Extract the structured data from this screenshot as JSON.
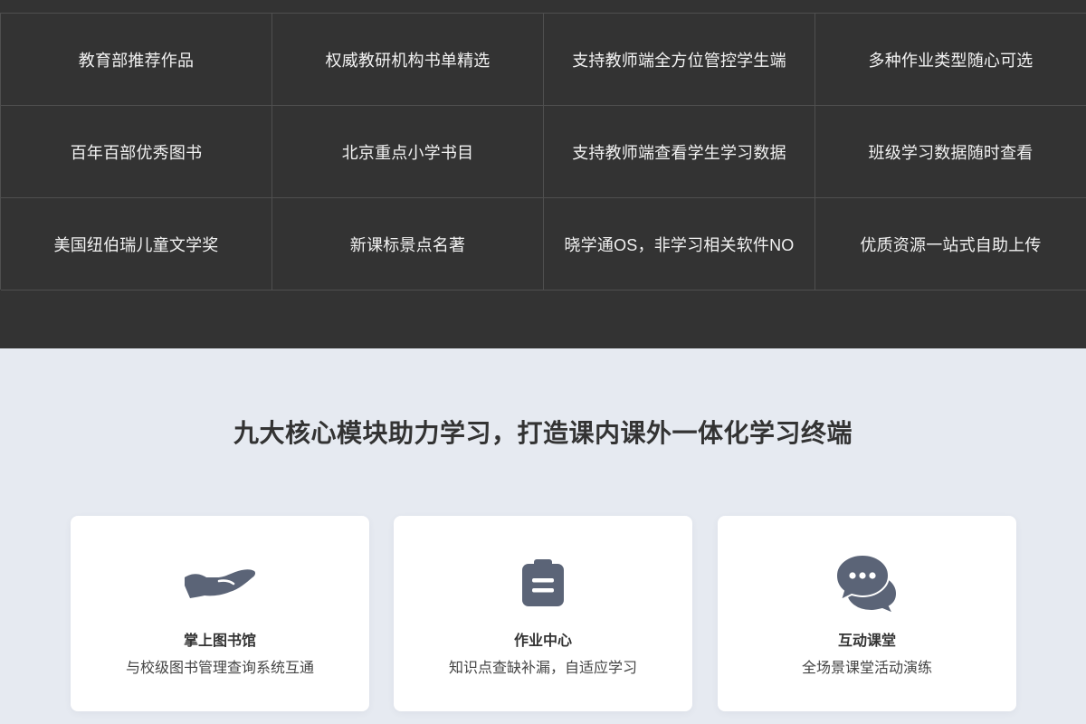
{
  "features": {
    "row1": [
      "教育部推荐作品",
      "权威教研机构书单精选",
      "支持教师端全方位管控学生端",
      "多种作业类型随心可选"
    ],
    "row2": [
      "百年百部优秀图书",
      "北京重点小学书目",
      "支持教师端查看学生学习数据",
      "班级学习数据随时查看"
    ],
    "row3": [
      "美国纽伯瑞儿童文学奖",
      "新课标景点名著",
      "晓学通OS，非学习相关软件NO",
      "优质资源一站式自助上传"
    ]
  },
  "section": {
    "headline": "九大核心模块助力学习，打造课内课外一体化学习终端"
  },
  "modules": [
    {
      "icon": "hand-icon",
      "title": "掌上图书馆",
      "desc": "与校级图书管理查询系统互通"
    },
    {
      "icon": "clipboard-icon",
      "title": "作业中心",
      "desc": "知识点查缺补漏，自适应学习"
    },
    {
      "icon": "chat-bubbles-icon",
      "title": "互动课堂",
      "desc": "全场景课堂活动演练"
    }
  ],
  "colors": {
    "dark_bg": "#333333",
    "light_bg": "#e6eaf1",
    "icon": "#5b6477"
  }
}
